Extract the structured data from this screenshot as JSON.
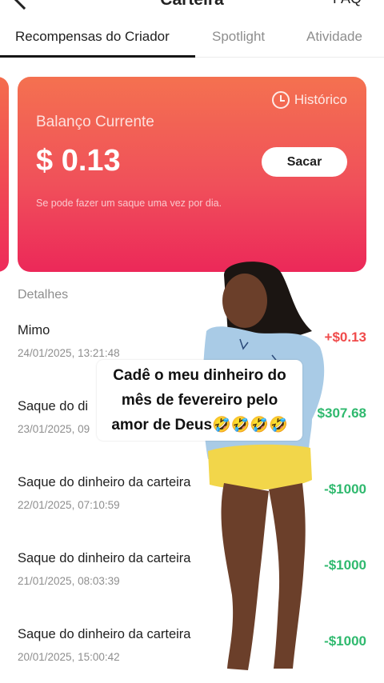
{
  "header": {
    "title": "Carteira",
    "faq_label": "FAQ"
  },
  "tabs": [
    {
      "label": "Recompensas do Criador",
      "active": true
    },
    {
      "label": "Spotlight",
      "active": false
    },
    {
      "label": "Atividade",
      "active": false
    }
  ],
  "balance_card": {
    "history_label": "Histórico",
    "balance_label": "Balanço Currente",
    "balance_value": "$ 0.13",
    "withdraw_label": "Sacar",
    "note": "Se pode fazer um saque uma vez por dia."
  },
  "details": {
    "section_title": "Detalhes",
    "rows": [
      {
        "title": "Mimo",
        "date": "24/01/2025, 13:21:48",
        "amount": "+$0.13"
      },
      {
        "title": "Saque do di",
        "date": "23/01/2025, 09",
        "amount": "$307.68"
      },
      {
        "title": "Saque do dinheiro da carteira",
        "date": "22/01/2025, 07:10:59",
        "amount": "-$1000"
      },
      {
        "title": "Saque do dinheiro da carteira",
        "date": "21/01/2025, 08:03:39",
        "amount": "-$1000"
      },
      {
        "title": "Saque do dinheiro da carteira",
        "date": "20/01/2025, 15:00:42",
        "amount": "-$1000"
      }
    ]
  },
  "overlay": {
    "caption": "Cadê o meu dinheiro do mês de fevereiro pelo amor de Deus🤣🤣🤣🤣"
  },
  "colors": {
    "card_top": "#f47150",
    "card_bottom": "#ec2859",
    "positive_red": "#f04b4b",
    "withdraw_green": "#2fb96e",
    "shirt_blue": "#a9cbe6",
    "shorts_yellow": "#f2d64a",
    "skin": "#6b3f2a"
  }
}
